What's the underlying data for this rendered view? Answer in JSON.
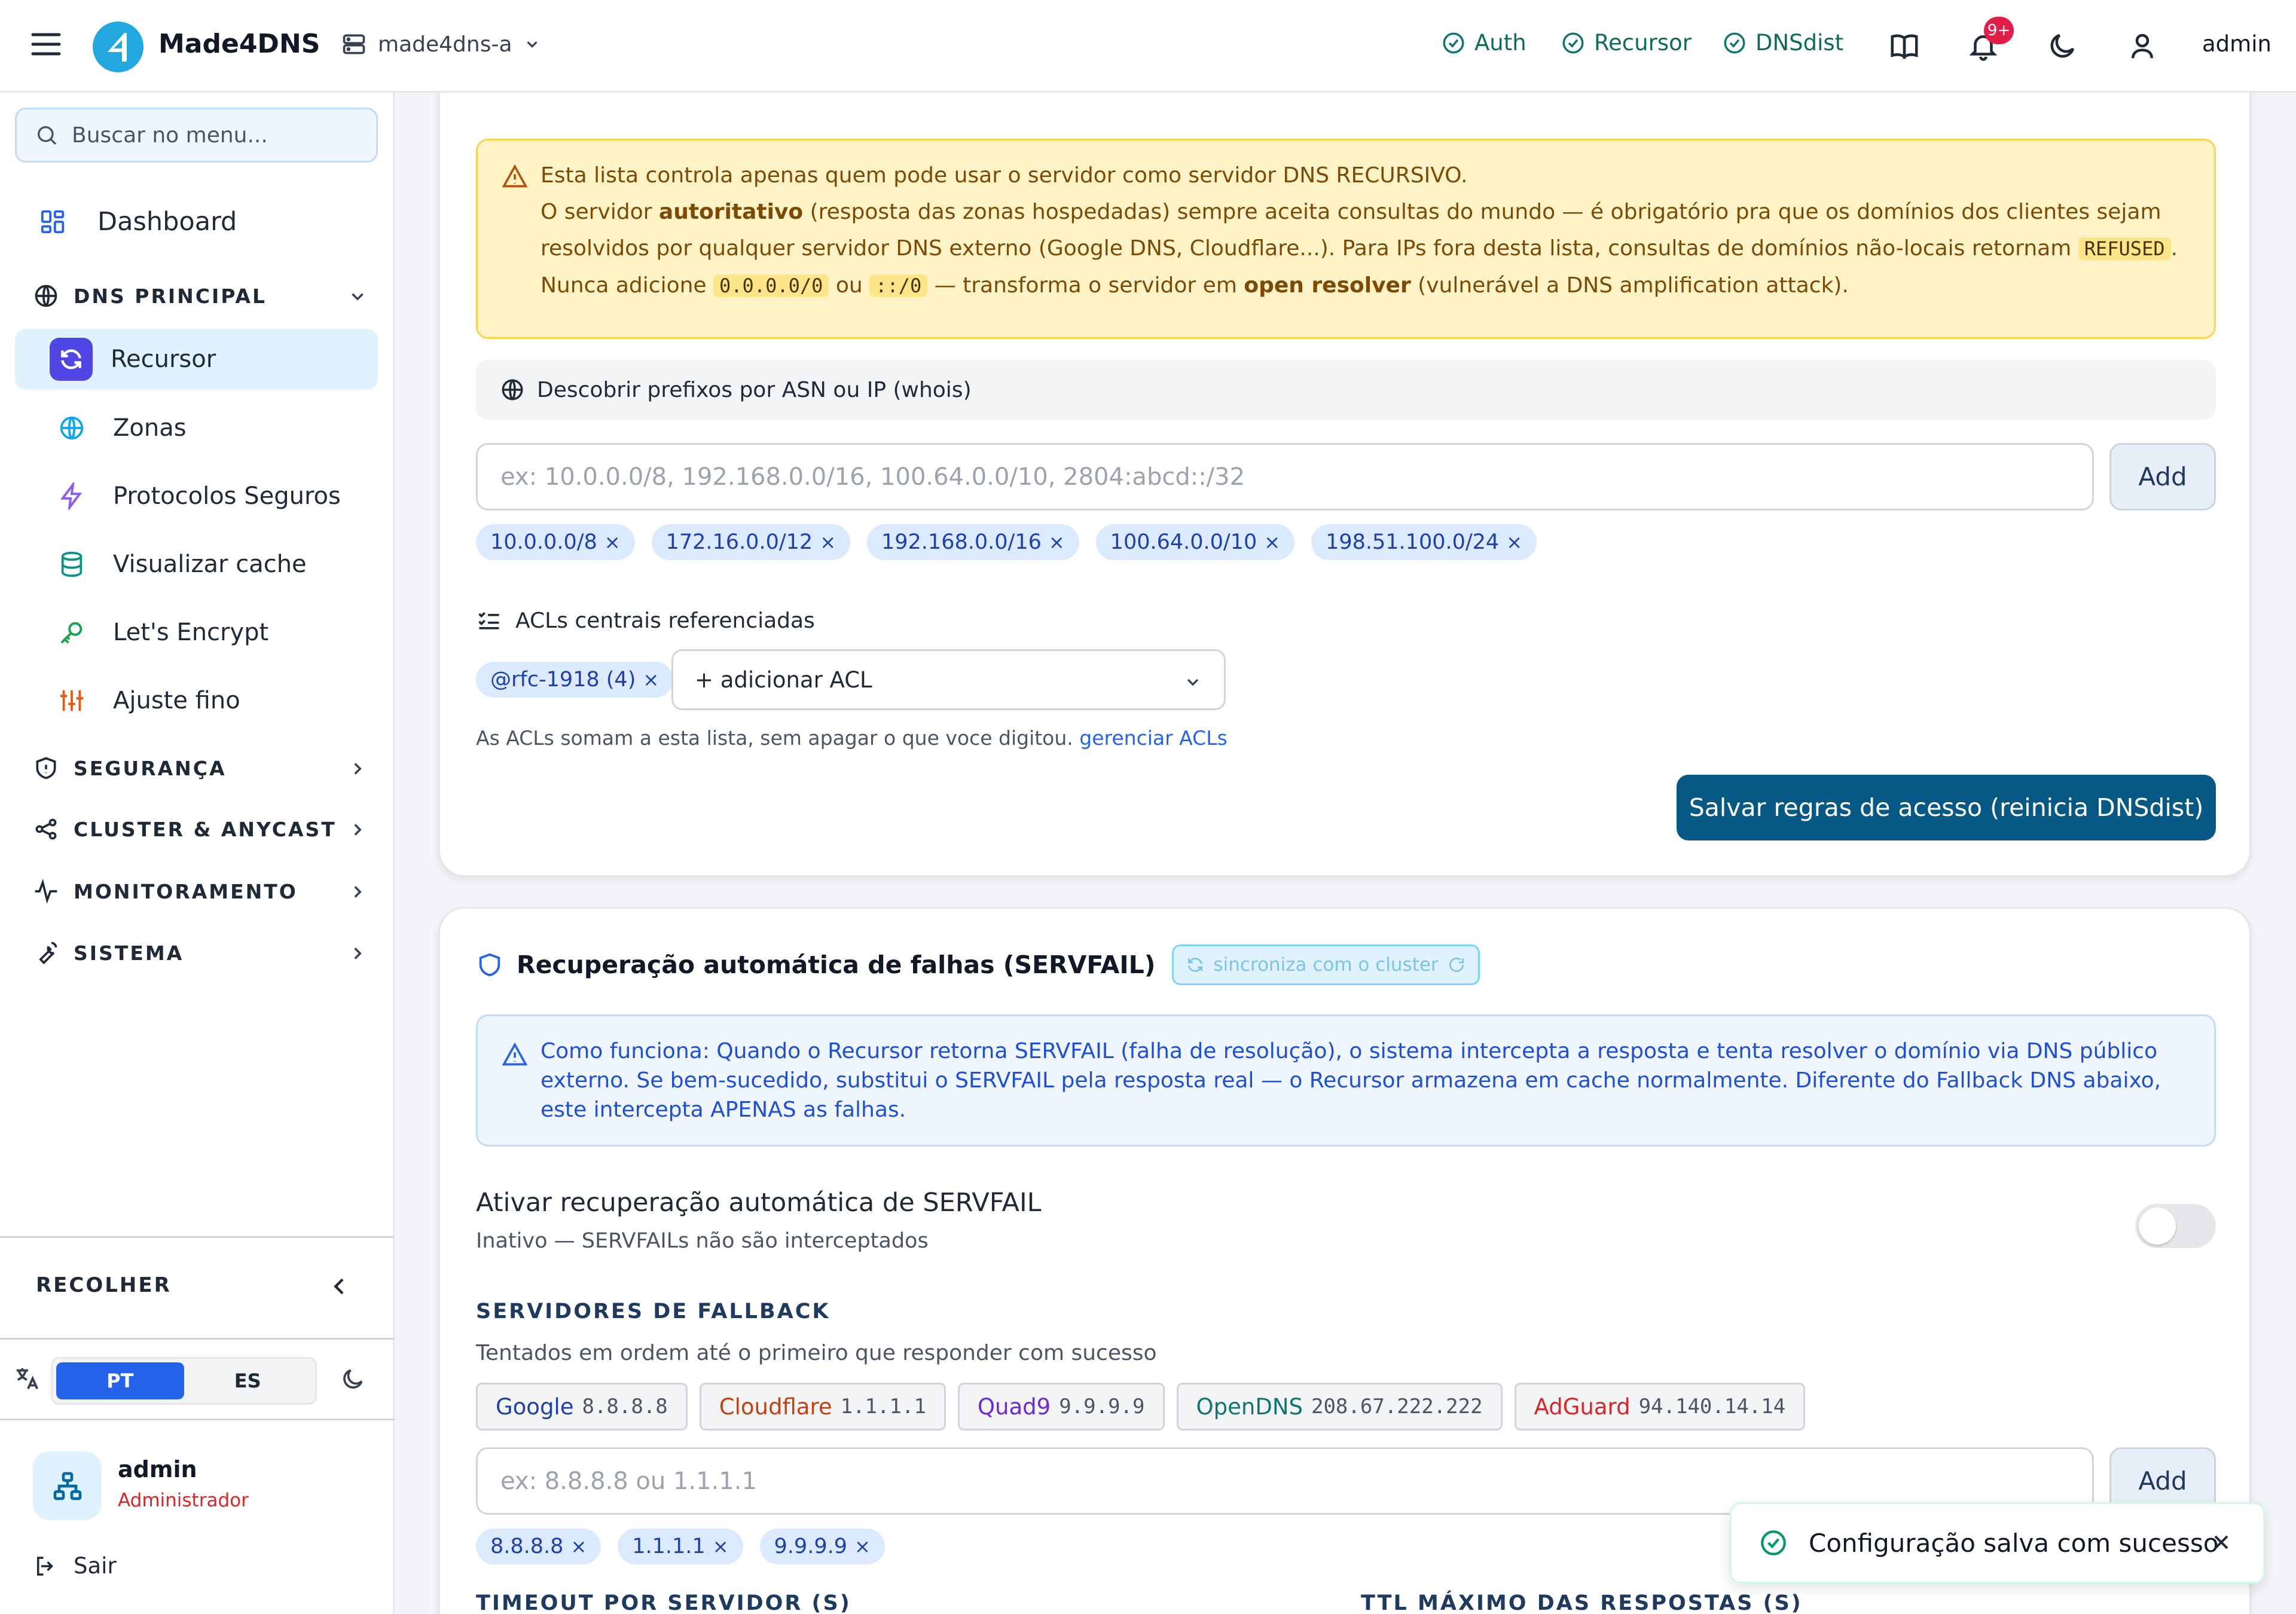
{
  "header": {
    "brand": "Made4DNS",
    "server": "made4dns-a",
    "services": [
      {
        "label": "Auth"
      },
      {
        "label": "Recursor"
      },
      {
        "label": "DNSdist"
      }
    ],
    "notifications_badge": "9+",
    "user": "admin"
  },
  "sidebar": {
    "search_placeholder": "Buscar no menu...",
    "dashboard": "Dashboard",
    "sections": {
      "dns_principal": "DNS PRINCIPAL",
      "seguranca": "SEGURANÇA",
      "cluster": "CLUSTER & ANYCAST",
      "monitoramento": "MONITORAMENTO",
      "sistema": "SISTEMA"
    },
    "items": [
      {
        "label": "Recursor",
        "icon": "refresh-icon"
      },
      {
        "label": "Zonas",
        "icon": "globe-icon"
      },
      {
        "label": "Protocolos Seguros",
        "icon": "bolt-icon"
      },
      {
        "label": "Visualizar cache",
        "icon": "database-icon"
      },
      {
        "label": "Let's Encrypt",
        "icon": "key-icon"
      },
      {
        "label": "Ajuste fino",
        "icon": "sliders-icon"
      }
    ],
    "collapse": "RECOLHER",
    "lang_pt": "PT",
    "lang_es": "ES",
    "user_name": "admin",
    "user_role": "Administrador",
    "logout": "Sair"
  },
  "acl_card": {
    "warning": {
      "line1": "Esta lista controla apenas quem pode usar o servidor como servidor DNS RECURSIVO.",
      "p_pre": "O servidor ",
      "p_bold1": "autoritativo",
      "p_mid1": " (resposta das zonas hospedadas) sempre aceita consultas do mundo — é obrigatório pra que os domínios dos clientes sejam resolvidos por qualquer servidor DNS externo (Google DNS, Cloudflare...). Para IPs fora desta lista, consultas de domínios não-locais retornam ",
      "code1": "REFUSED",
      "p_mid2": ". Nunca adicione ",
      "code2": "0.0.0.0/0",
      "p_or": " ou ",
      "code3": "::/0",
      "p_mid3": " — transforma o servidor em ",
      "p_bold2": "open resolver",
      "p_end": " (vulnerável a DNS amplification attack)."
    },
    "whois": "Descobrir prefixos por ASN ou IP (whois)",
    "input_placeholder": "ex: 10.0.0.0/8, 192.168.0.0/16, 100.64.0.0/10, 2804:abcd::/32",
    "add": "Add",
    "chips": [
      "10.0.0.0/8",
      "172.16.0.0/12",
      "192.168.0.0/16",
      "100.64.0.0/10",
      "198.51.100.0/24"
    ],
    "acl_header": "ACLs centrais referenciadas",
    "acl_chip": "@rfc-1918 (4)",
    "acl_select": "+ adicionar ACL",
    "acl_note": "As ACLs somam a esta lista, sem apagar o que voce digitou. ",
    "acl_link": "gerenciar ACLs",
    "save": "Salvar regras de acesso (reinicia DNSdist)"
  },
  "servfail_card": {
    "title": "Recuperação automática de falhas (SERVFAIL)",
    "sync": "sincroniza com o cluster",
    "info": "Como funciona: Quando o Recursor retorna SERVFAIL (falha de resolução), o sistema intercepta a resposta e tenta resolver o domínio via DNS público externo. Se bem-sucedido, substitui o SERVFAIL pela resposta real — o Recursor armazena em cache normalmente. Diferente do Fallback DNS abaixo, este intercepta APENAS as falhas.",
    "toggle_label": "Ativar recuperação automática de SERVFAIL",
    "toggle_sub": "Inativo — SERVFAILs não são interceptados",
    "toggle_on": false,
    "fallback_title": "SERVIDORES DE FALLBACK",
    "fallback_sub": "Tentados em ordem até o primeiro que responder com sucesso",
    "presets": [
      {
        "name": "Google",
        "ip": "8.8.8.8",
        "color": "#1e40af"
      },
      {
        "name": "Cloudflare",
        "ip": "1.1.1.1",
        "color": "#c2410c"
      },
      {
        "name": "Quad9",
        "ip": "9.9.9.9",
        "color": "#6d28d9"
      },
      {
        "name": "OpenDNS",
        "ip": "208.67.222.222",
        "color": "#0f766e"
      },
      {
        "name": "AdGuard",
        "ip": "94.140.14.14",
        "color": "#dc2626"
      }
    ],
    "input_placeholder": "ex: 8.8.8.8 ou 1.1.1.1",
    "add": "Add",
    "chips": [
      "8.8.8.8",
      "1.1.1.1",
      "9.9.9.9"
    ],
    "col_timeout": "TIMEOUT POR SERVIDOR (S)",
    "col_ttl": "TTL MÁXIMO DAS RESPOSTAS (S)"
  },
  "toast": {
    "message": "Configuração salva com sucesso"
  }
}
